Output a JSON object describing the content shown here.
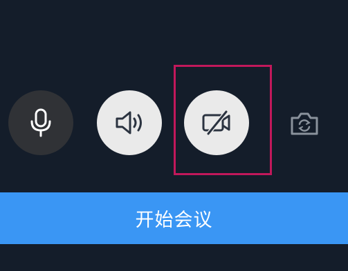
{
  "controls": {
    "mic_icon": "microphone-icon",
    "speaker_icon": "speaker-icon",
    "camera_icon": "camera-off-icon",
    "switch_camera_icon": "switch-camera-icon"
  },
  "start_button": {
    "label": "开始会议"
  },
  "colors": {
    "background": "#141d2a",
    "primary": "#3a96f4",
    "highlight": "#c2185b"
  }
}
